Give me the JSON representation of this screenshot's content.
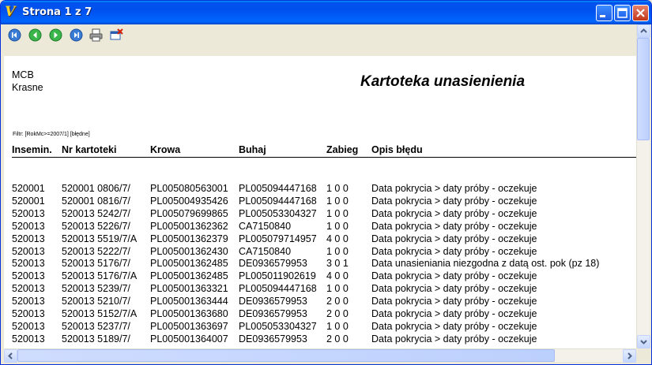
{
  "window": {
    "title": "Strona 1 z 7"
  },
  "toolbar": {
    "icons": [
      "first-page-icon",
      "previous-page-icon",
      "next-page-icon",
      "last-page-icon",
      "printer-icon",
      "close-preview-icon"
    ]
  },
  "report": {
    "company_line1": "MCB",
    "company_line2": "Krasne",
    "title": "Kartoteka unasienienia",
    "filter": "Filtr: [RokMc>=2007/1] [błędne]",
    "columns": [
      "Insemin.",
      "Nr kartoteki",
      "Krowa",
      "Buhaj",
      "Zabieg",
      "Opis błędu"
    ],
    "rows": [
      [
        "520001",
        "520001 0806/7/",
        "PL005080563001",
        "PL005094447168",
        "1 0 0",
        "Data pokrycia > daty próby - oczekuje"
      ],
      [
        "520001",
        "520001 0816/7/",
        "PL005004935426",
        "PL005094447168",
        "1 0 0",
        "Data pokrycia > daty próby - oczekuje"
      ],
      [
        "520013",
        "520013 5242/7/",
        "PL005079699865",
        "PL005053304327",
        "1 0 0",
        "Data pokrycia > daty próby - oczekuje"
      ],
      [
        "520013",
        "520013 5226/7/",
        "PL005001362362",
        "CA7150840",
        "1 0 0",
        "Data pokrycia > daty próby - oczekuje"
      ],
      [
        "520013",
        "520013 5519/7/A",
        "PL005001362379",
        "PL005079714957",
        "4 0 0",
        "Data pokrycia > daty próby - oczekuje"
      ],
      [
        "520013",
        "520013 5222/7/",
        "PL005001362430",
        "CA7150840",
        "1 0 0",
        "Data pokrycia > daty próby - oczekuje"
      ],
      [
        "520013",
        "520013 5176/7/",
        "PL005001362485",
        "DE0936579953",
        "3 0 1",
        "Data unasieniania niezgodna z datą ost. pok (pz 18)"
      ],
      [
        "520013",
        "520013 5176/7/A",
        "PL005001362485",
        "PL005011902619",
        "4 0 0",
        "Data pokrycia > daty próby - oczekuje"
      ],
      [
        "520013",
        "520013 5239/7/",
        "PL005001363321",
        "PL005094447168",
        "1 0 0",
        "Data pokrycia > daty próby - oczekuje"
      ],
      [
        "520013",
        "520013 5210/7/",
        "PL005001363444",
        "DE0936579953",
        "2 0 0",
        "Data pokrycia > daty próby - oczekuje"
      ],
      [
        "520013",
        "520013 5152/7/A",
        "PL005001363680",
        "DE0936579953",
        "2 0 0",
        "Data pokrycia > daty próby - oczekuje"
      ],
      [
        "520013",
        "520013 5237/7/",
        "PL005001363697",
        "PL005053304327",
        "1 0 0",
        "Data pokrycia > daty próby - oczekuje"
      ],
      [
        "520013",
        "520013 5189/7/",
        "PL005001364007",
        "DE0936579953",
        "2 0 0",
        "Data pokrycia > daty próby - oczekuje"
      ]
    ]
  }
}
